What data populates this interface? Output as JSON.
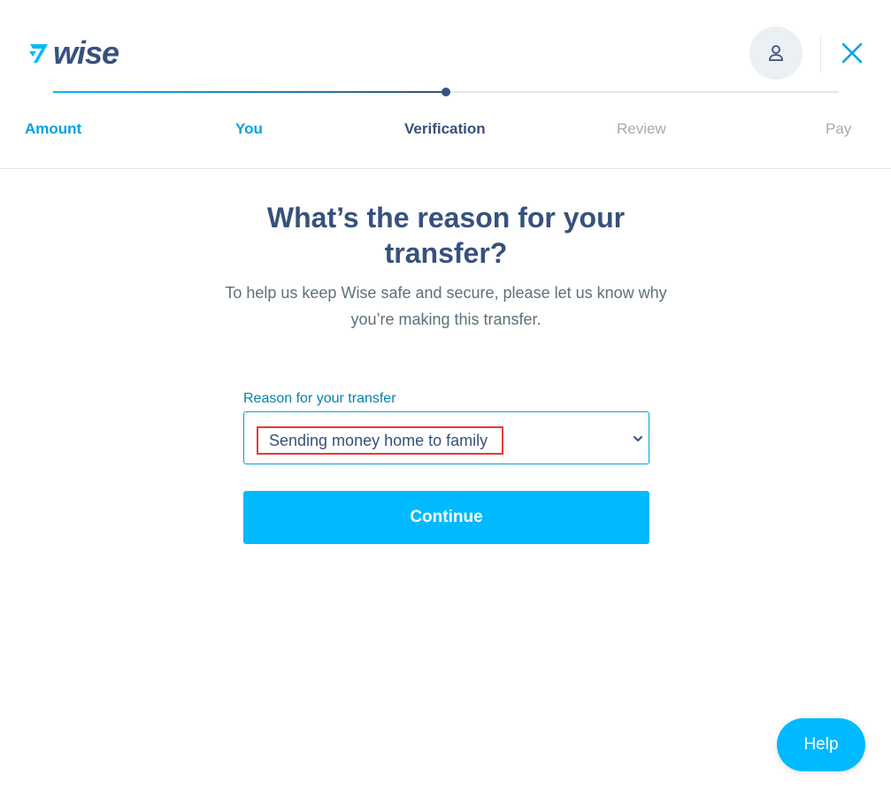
{
  "header": {
    "logo_text": "wise",
    "brand_color": "#37517e",
    "accent_color": "#00b9ff"
  },
  "progress": {
    "fraction": 0.5,
    "steps": [
      {
        "label": "Amount",
        "state": "done"
      },
      {
        "label": "You",
        "state": "done"
      },
      {
        "label": "Verification",
        "state": "active"
      },
      {
        "label": "Review",
        "state": "future"
      },
      {
        "label": "Pay",
        "state": "future"
      }
    ]
  },
  "main": {
    "title": "What’s the reason for your transfer?",
    "subtitle": "To help us keep Wise safe and secure, please let us know why you’re making this transfer.",
    "reason_label": "Reason for your transfer",
    "reason_value": "Sending money home to family",
    "continue_label": "Continue"
  },
  "help": {
    "label": "Help"
  },
  "icons": {
    "logo": "wise-flag-icon",
    "avatar": "user-icon",
    "close": "close-icon",
    "select": "chevron-down-icon"
  }
}
